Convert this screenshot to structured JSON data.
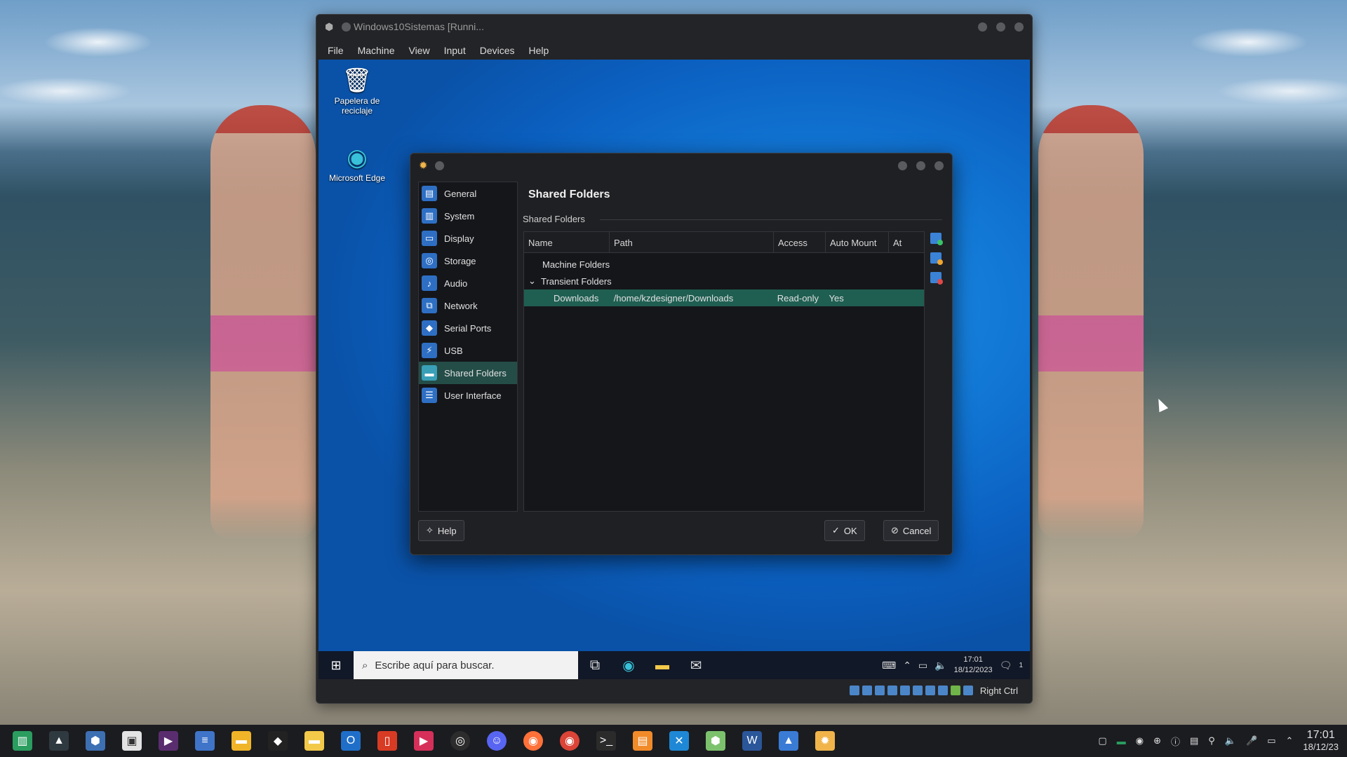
{
  "vm_window": {
    "title": "Windows10Sistemas [Runni...",
    "menu": [
      "File",
      "Machine",
      "View",
      "Input",
      "Devices",
      "Help"
    ],
    "status_host_key": "Right Ctrl"
  },
  "guest_desktop": {
    "icons": [
      {
        "label": "Papelera de reciclaje",
        "icon": "recycle-bin-icon"
      },
      {
        "label": "Microsoft Edge",
        "icon": "edge-icon"
      }
    ],
    "taskbar": {
      "search_placeholder": "Escribe aquí para buscar.",
      "time": "17:01",
      "date": "18/12/2023",
      "notification_count": "1"
    }
  },
  "settings_dialog": {
    "page_title": "Shared Folders",
    "section_label": "Shared Folders",
    "sidebar": [
      {
        "label": "General",
        "icon": "general-icon",
        "selected": false
      },
      {
        "label": "System",
        "icon": "system-icon",
        "selected": false
      },
      {
        "label": "Display",
        "icon": "display-icon",
        "selected": false
      },
      {
        "label": "Storage",
        "icon": "storage-icon",
        "selected": false
      },
      {
        "label": "Audio",
        "icon": "audio-icon",
        "selected": false
      },
      {
        "label": "Network",
        "icon": "network-icon",
        "selected": false
      },
      {
        "label": "Serial Ports",
        "icon": "serial-ports-icon",
        "selected": false
      },
      {
        "label": "USB",
        "icon": "usb-icon",
        "selected": false
      },
      {
        "label": "Shared Folders",
        "icon": "shared-folders-icon",
        "selected": true
      },
      {
        "label": "User Interface",
        "icon": "user-interface-icon",
        "selected": false
      }
    ],
    "columns": [
      "Name",
      "Path",
      "Access",
      "Auto Mount",
      "At"
    ],
    "tree": {
      "machine_folders": "Machine Folders",
      "transient_folders": "Transient Folders",
      "rows": [
        {
          "name": "Downloads",
          "path": "/home/kzdesigner/Downloads",
          "access": "Read-only",
          "auto_mount": "Yes",
          "at": ""
        }
      ]
    },
    "buttons": {
      "help": "Help",
      "ok": "OK",
      "cancel": "Cancel"
    }
  },
  "host_taskbar": {
    "time": "17:01",
    "date": "18/12/23"
  },
  "colors": {
    "selection": "#1f5f52",
    "sidebar_selection": "#244d48",
    "guest_wallpaper": "#1278d6"
  }
}
